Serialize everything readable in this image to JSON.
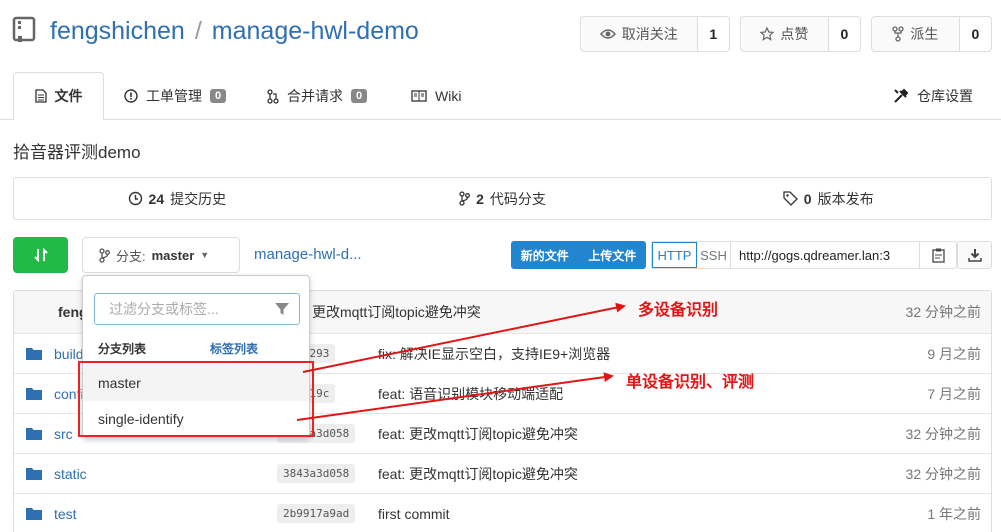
{
  "repo": {
    "owner": "fengshichen",
    "separator": "/",
    "name": "manage-hwl-demo"
  },
  "actions": {
    "unwatch": {
      "label": "取消关注",
      "count": "1"
    },
    "star": {
      "label": "点赞",
      "count": "0"
    },
    "fork": {
      "label": "派生",
      "count": "0"
    }
  },
  "tabs": {
    "files": "文件",
    "issues": {
      "label": "工单管理",
      "count": "0"
    },
    "pulls": {
      "label": "合并请求",
      "count": "0"
    },
    "wiki": "Wiki",
    "settings": "仓库设置"
  },
  "description": "拾音器评测demo",
  "stats": {
    "commits": {
      "count": "24",
      "label": "提交历史"
    },
    "branches": {
      "count": "2",
      "label": "代码分支"
    },
    "releases": {
      "count": "0",
      "label": "版本发布"
    }
  },
  "branch_selector": {
    "prefix": "分支:",
    "current": "master"
  },
  "path_link": "manage-hwl-d...",
  "file_actions": {
    "new_file": "新的文件",
    "upload": "上传文件"
  },
  "clone": {
    "http": "HTTP",
    "ssh": "SSH",
    "url": "http://gogs.qdreamer.lan:3"
  },
  "dropdown": {
    "filter_placeholder": "过滤分支或标签...",
    "tab_branches": "分支列表",
    "tab_tags": "标签列表",
    "branches": [
      "master",
      "single-identify"
    ]
  },
  "latest_commit": {
    "author": "feng",
    "message": "更改mqtt订阅topic避免冲突",
    "when": "32 分钟之前"
  },
  "files": [
    {
      "name": "build",
      "sha": "87f5293",
      "message": "fix: 解决IE显示空白，支持IE9+浏览器",
      "when": "9 月之前"
    },
    {
      "name": "config",
      "sha": "846419c",
      "message": "feat: 语音识别模块移动端适配",
      "when": "7 月之前"
    },
    {
      "name": "src",
      "sha": "3843a3d058",
      "message": "feat: 更改mqtt订阅topic避免冲突",
      "when": "32 分钟之前"
    },
    {
      "name": "static",
      "sha": "3843a3d058",
      "message": "feat: 更改mqtt订阅topic避免冲突",
      "when": "32 分钟之前"
    },
    {
      "name": "test",
      "sha": "2b9917a9ad",
      "message": "first commit",
      "when": "1 年之前"
    }
  ],
  "annotations": {
    "multi": "多设备识别",
    "single": "单设备识别、评测"
  },
  "colors": {
    "link": "#2f6fb3",
    "primary": "#2185d0",
    "success": "#21ba45",
    "annotation": "#e21515"
  }
}
